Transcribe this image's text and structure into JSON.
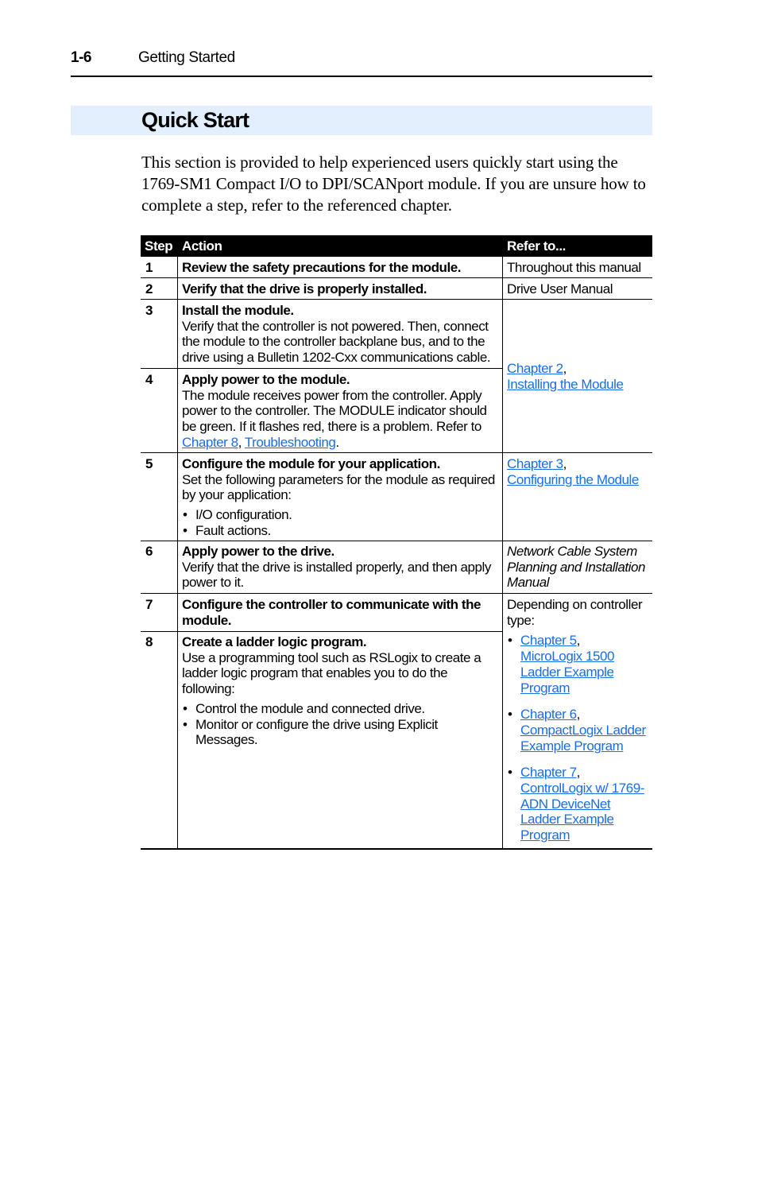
{
  "page_header": {
    "page_number": "1-6",
    "chapter_title": "Getting Started"
  },
  "section": {
    "title": "Quick Start",
    "intro": "This section is provided to help experienced users quickly start using the 1769-SM1 Compact I/O to DPI/SCANport module. If you are unsure how to complete a step, refer to the referenced chapter."
  },
  "colors": {
    "band_background": "#e3effc",
    "link": "#1a6ee6",
    "table_header_bg": "#000000"
  },
  "table": {
    "headers": {
      "step": "Step",
      "action": "Action",
      "refer": "Refer to..."
    },
    "rows": [
      {
        "step": "1",
        "title": "Review the safety precautions for the module."
      },
      {
        "step": "2",
        "title": "Verify that the drive is properly installed."
      },
      {
        "step": "3",
        "title": "Install the module.",
        "body": "Verify that the controller is not powered. Then, connect the module to the controller backplane bus, and to the drive using a Bulletin 1202-Cxx communications cable."
      },
      {
        "step": "4",
        "title": "Apply power to the module.",
        "body": "The module receives power from the controller. Apply power to the controller. The MODULE indicator should be green. If it flashes red, there is a problem. Refer to",
        "link1": "Chapter 8",
        "sep": ", ",
        "link2": "Troubleshooting",
        "end": "."
      },
      {
        "step": "5",
        "title": "Configure the module for your application.",
        "body": "Set the following parameters for the module as required by your application:",
        "bullets": [
          "I/O configuration.",
          "Fault actions."
        ]
      },
      {
        "step": "6",
        "title": "Apply power to the drive.",
        "body": "Verify that the drive is installed properly, and then apply power to it."
      },
      {
        "step": "7",
        "title": "Configure the controller to communicate with the module."
      },
      {
        "step": "8",
        "title": "Create a ladder logic program.",
        "body": "Use a programming tool such as RSLogix to create a ladder logic program that enables you to do the following:",
        "bullets": [
          "Control the module and connected drive.",
          "Monitor or configure the drive using Explicit Messages."
        ]
      }
    ],
    "refs": {
      "r1": "Throughout this manual",
      "r2": "Drive User Manual",
      "r34": {
        "chapter": "Chapter 2",
        "comma": ",",
        "title": "Installing the Module"
      },
      "r5": {
        "chapter": "Chapter 3",
        "comma": ",",
        "title": "Configuring the Module"
      },
      "r6": "Network Cable System Planning and Installation Manual",
      "r78": {
        "intro": "Depending on controller type:",
        "items": [
          {
            "chapter": "Chapter 5",
            "comma": ",",
            "title": "MicroLogix 1500 Ladder Example Program"
          },
          {
            "chapter": "Chapter 6",
            "comma": ",",
            "title": "CompactLogix Ladder Example Program"
          },
          {
            "chapter": "Chapter 7",
            "comma": ",",
            "title": "ControlLogix w/ 1769-ADN DeviceNet Ladder Example Program"
          }
        ]
      }
    }
  }
}
